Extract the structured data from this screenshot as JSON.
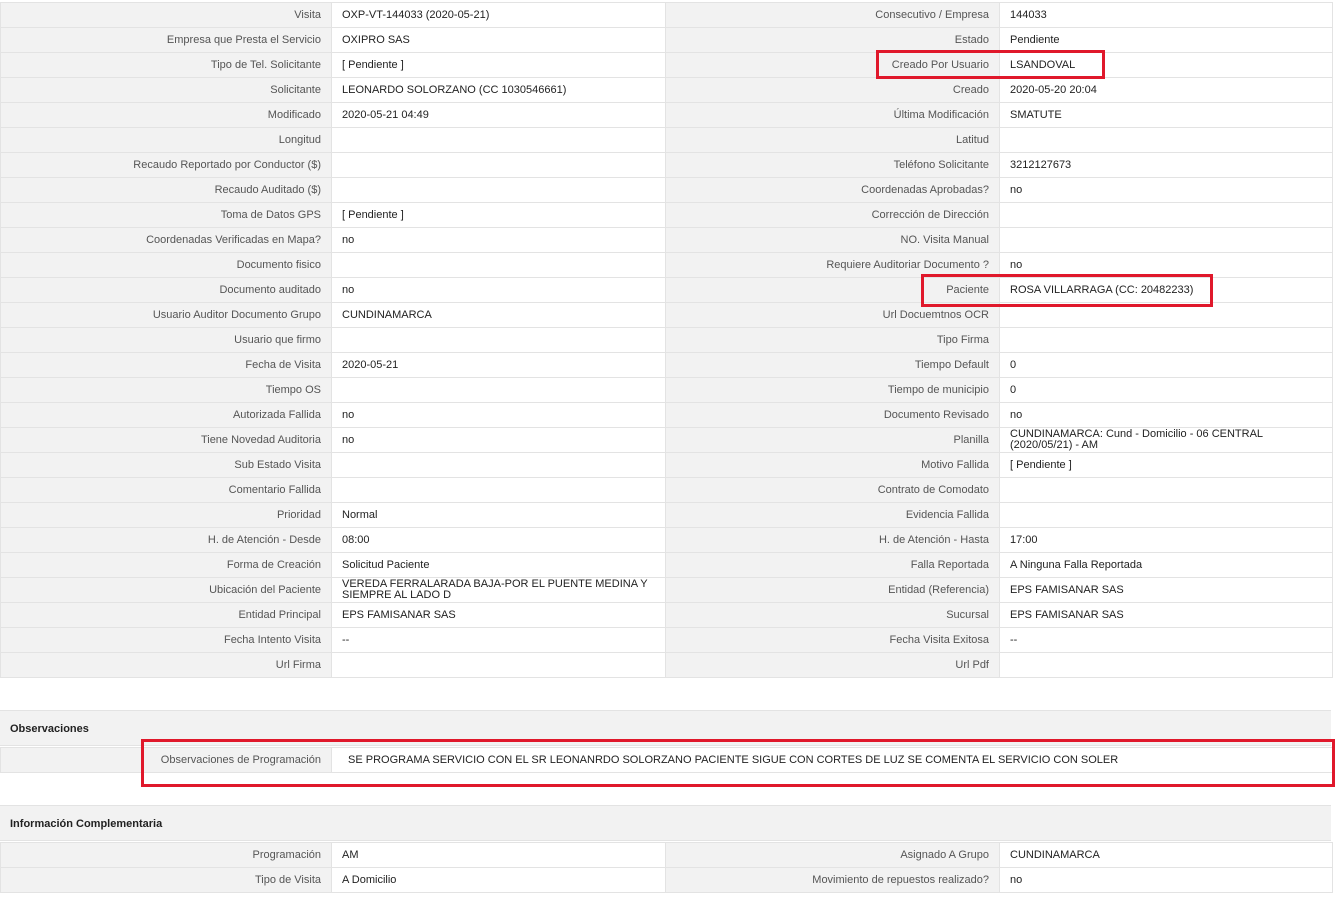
{
  "main_rows": [
    {
      "l1": "Visita",
      "v1": "OXP-VT-144033 (2020-05-21)",
      "l2": "Consecutivo / Empresa",
      "v2": "144033"
    },
    {
      "l1": "Empresa que Presta el Servicio",
      "v1": "OXIPRO SAS",
      "l2": "Estado",
      "v2": "Pendiente"
    },
    {
      "l1": "Tipo de Tel. Solicitante",
      "v1": "[ Pendiente ]",
      "l2": "Creado Por Usuario",
      "v2": "LSANDOVAL"
    },
    {
      "l1": "Solicitante",
      "v1": "LEONARDO SOLORZANO (CC 1030546661)",
      "l2": "Creado",
      "v2": "2020-05-20 20:04"
    },
    {
      "l1": "Modificado",
      "v1": "2020-05-21 04:49",
      "l2": "Última Modificación",
      "v2": "SMATUTE"
    },
    {
      "l1": "Longitud",
      "v1": "",
      "l2": "Latitud",
      "v2": ""
    },
    {
      "l1": "Recaudo Reportado por Conductor ($)",
      "v1": "",
      "l2": "Teléfono Solicitante",
      "v2": "3212127673"
    },
    {
      "l1": "Recaudo Auditado ($)",
      "v1": "",
      "l2": "Coordenadas Aprobadas?",
      "v2": "no"
    },
    {
      "l1": "Toma de Datos GPS",
      "v1": "[ Pendiente ]",
      "l2": "Corrección de Dirección",
      "v2": ""
    },
    {
      "l1": "Coordenadas Verificadas en Mapa?",
      "v1": "no",
      "l2": "NO. Visita Manual",
      "v2": ""
    },
    {
      "l1": "Documento fisico",
      "v1": "",
      "l2": "Requiere Auditoriar Documento ?",
      "v2": "no"
    },
    {
      "l1": "Documento auditado",
      "v1": "no",
      "l2": "Paciente",
      "v2": "ROSA VILLARRAGA (CC: 20482233)"
    },
    {
      "l1": "Usuario Auditor Documento Grupo",
      "v1": "CUNDINAMARCA",
      "l2": "Url Docuemtnos OCR",
      "v2": ""
    },
    {
      "l1": "Usuario que firmo",
      "v1": "",
      "l2": "Tipo Firma",
      "v2": ""
    },
    {
      "l1": "Fecha de Visita",
      "v1": "2020-05-21",
      "l2": "Tiempo Default",
      "v2": "0"
    },
    {
      "l1": "Tiempo OS",
      "v1": "",
      "l2": "Tiempo de municipio",
      "v2": "0"
    },
    {
      "l1": "Autorizada Fallida",
      "v1": "no",
      "l2": "Documento Revisado",
      "v2": "no"
    },
    {
      "l1": "Tiene Novedad Auditoria",
      "v1": "no",
      "l2": "Planilla",
      "v2": "CUNDINAMARCA: Cund - Domicilio - 06 CENTRAL (2020/05/21) - AM"
    },
    {
      "l1": "Sub Estado Visita",
      "v1": "",
      "l2": "Motivo Fallida",
      "v2": "[ Pendiente ]"
    },
    {
      "l1": "Comentario Fallida",
      "v1": "",
      "l2": "Contrato de Comodato",
      "v2": ""
    },
    {
      "l1": "Prioridad",
      "v1": "Normal",
      "l2": "Evidencia Fallida",
      "v2": ""
    },
    {
      "l1": "H. de Atención - Desde",
      "v1": "08:00",
      "l2": "H. de Atención - Hasta",
      "v2": "17:00"
    },
    {
      "l1": "Forma de Creación",
      "v1": "Solicitud Paciente",
      "l2": "Falla Reportada",
      "v2": "A Ninguna Falla Reportada"
    },
    {
      "l1": "Ubicación del Paciente",
      "v1": "VEREDA FERRALARADA BAJA-POR EL PUENTE MEDINA Y SIEMPRE AL LADO D",
      "l2": "Entidad (Referencia)",
      "v2": "EPS FAMISANAR SAS"
    },
    {
      "l1": "Entidad Principal",
      "v1": "EPS FAMISANAR SAS",
      "l2": "Sucursal",
      "v2": "EPS FAMISANAR SAS"
    },
    {
      "l1": "Fecha Intento Visita",
      "v1": "--",
      "l2": "Fecha Visita Exitosa",
      "v2": "--"
    },
    {
      "l1": "Url Firma",
      "v1": "",
      "l2": "Url Pdf",
      "v2": ""
    }
  ],
  "observaciones": {
    "title": "Observaciones",
    "label": "Observaciones de Programación",
    "value": "SE PROGRAMA SERVICIO CON EL SR LEONANRDO SOLORZANO PACIENTE SIGUE CON CORTES DE LUZ SE COMENTA EL SERVICIO CON SOLER"
  },
  "info": {
    "title": "Información Complementaria",
    "rows": [
      {
        "l1": "Programación",
        "v1": "AM",
        "l2": "Asignado A Grupo",
        "v2": "CUNDINAMARCA"
      },
      {
        "l1": "Tipo de Visita",
        "v1": "A Domicilio",
        "l2": "Movimiento de repuestos realizado?",
        "v2": "no"
      }
    ]
  },
  "highlight_color": "#e0182b"
}
